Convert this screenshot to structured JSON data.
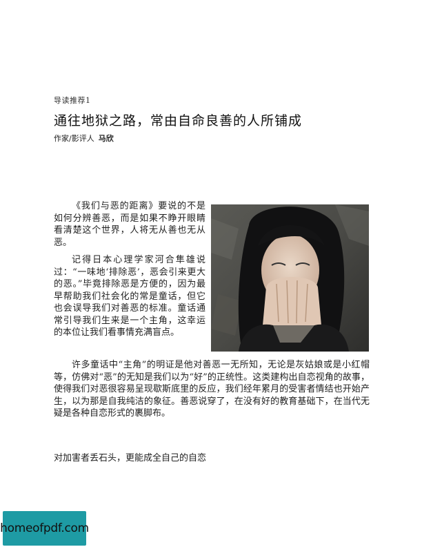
{
  "section_label": "导读推荐1",
  "title": "通往地狱之路，常由自命良善的人所铺成",
  "byline": {
    "role": "作家/影评人",
    "name": "马欣"
  },
  "paragraphs": [
    "《我们与恶的距离》要说的不是如何分辨善恶，而是如果不睁开眼睛看清楚这个世界，人将无从善也无从恶。",
    "记得日本心理学家河合隼雄说过：“一味地‘排除恶’，恶会引来更大的恶。”毕竟排除恶是方便的，因为最早帮助我们社会化的常是童话，但它也会误导我们对善恶的标准。童话通常引导我们生来是一个主角，这幸运的本位让我们看事情充满盲点。",
    "许多童话中“主角”的明证是他对善恶一无所知，无论是灰姑娘或是小红帽等，仿佛对“恶”的无知是我们以为“好”的正统性。这类建构出自恋视角的故事，使得我们对恶很容易呈现歇斯底里的反应，我们经年累月的受害者情结也开始产生，以为那是自我纯洁的象征。善恶说穿了，在没有好的教育基础下，在当代无疑是各种自恋形式的裹脚布。"
  ],
  "subheading": "对加害者丢石头，更能成全自己的自恋",
  "watermark": "homeofpdf.com"
}
